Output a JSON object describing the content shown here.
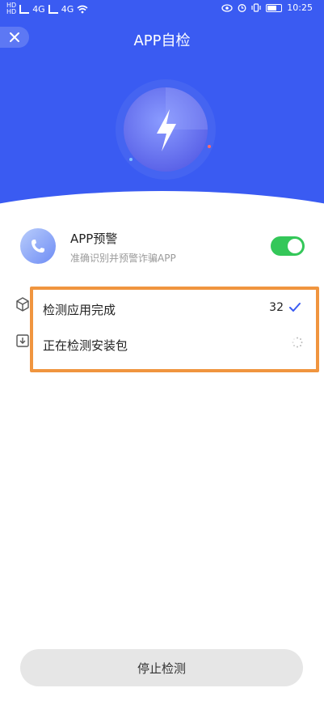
{
  "status": {
    "time": "10:25",
    "left_tags": [
      "4G",
      "4G"
    ]
  },
  "header": {
    "title": "APP自检"
  },
  "colors": {
    "primary": "#3a5bf2",
    "toggle_on": "#34c759",
    "highlight": "#f0953f"
  },
  "icons": {
    "close": "close-icon",
    "hero": "lightning-icon",
    "app": "phone-icon",
    "apps": "cube-icon",
    "download": "download-box-icon",
    "check": "check-icon",
    "spinner": "loading-spinner-icon"
  },
  "app_warning": {
    "title": "APP预警",
    "subtitle": "准确识别并预警诈骗APP",
    "enabled": true
  },
  "checks": [
    {
      "label": "检测应用完成",
      "count": "32",
      "status": "done"
    },
    {
      "label": "正在检测安装包",
      "status": "loading"
    }
  ],
  "footer": {
    "stop_label": "停止检测"
  }
}
